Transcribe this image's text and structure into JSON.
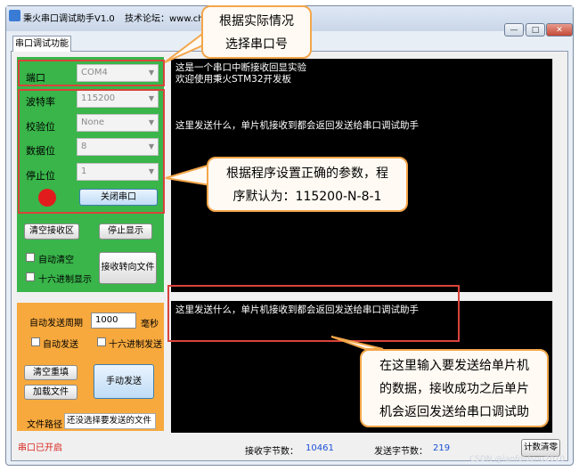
{
  "window": {
    "title": "秉火串口调试助手V1.0",
    "title_extra": "技术论坛：www.chu",
    "tab": "串口调试功能",
    "controls": {
      "minimize": "—",
      "maximize": "□",
      "close": "✕"
    }
  },
  "serial": {
    "port_label": "端口",
    "port_value": "COM4",
    "baud_label": "波特率",
    "baud_value": "115200",
    "parity_label": "校验位",
    "parity_value": "None",
    "data_label": "数据位",
    "data_value": "8",
    "stop_label": "停止位",
    "stop_value": "1",
    "close_button": "关闭串口",
    "indicator_color": "#e21c1c"
  },
  "receive": {
    "clear_button": "清空接收区",
    "stop_button": "停止显示",
    "auto_clear_label": "自动清空",
    "hex_display_label": "十六进制显示",
    "redirect_button": "接收转向文件",
    "lines": [
      "这是一个串口中断接收回显实验",
      "欢迎使用秉火STM32开发板",
      "",
      "",
      "",
      "这里发送什么，单片机接收到都会返回发送给串口调试助手"
    ]
  },
  "send": {
    "period_label": "自动发送周期",
    "period_value": "1000",
    "period_unit": "毫秒",
    "auto_send_label": "自动发送",
    "hex_send_label": "十六进制发送",
    "clear_resend_button": "清空重填",
    "load_file_button": "加载文件",
    "manual_send_button": "手动发送",
    "file_path_label": "文件路径",
    "file_path_value": "还没选择要发送的文件",
    "input_text": "这里发送什么，单片机接收到都会返回发送给串口调试助手"
  },
  "status": {
    "port_state": "串口已开启",
    "rx_label": "接收字节数：",
    "rx_value": "10461",
    "tx_label": "发送字节数：",
    "tx_value": "219",
    "reset_button": "计数清零"
  },
  "callouts": {
    "select_port": [
      "根据实际情况",
      "选择串口号"
    ],
    "set_params": [
      "根据程序设置正确的参数，程",
      "序默认为：115200-N-8-1"
    ],
    "send_input": [
      "在这里输入要发送给单片机",
      "的数据，接收成功之后单片",
      "机会返回发送给串口调试助"
    ]
  },
  "watermark": "CSDN @lanfoldsnu2010",
  "colors": {
    "green_panel": "#39b54a",
    "orange_panel": "#f7a93d",
    "annotation_red": "#d9433b",
    "callout_border": "#f3a64a"
  }
}
